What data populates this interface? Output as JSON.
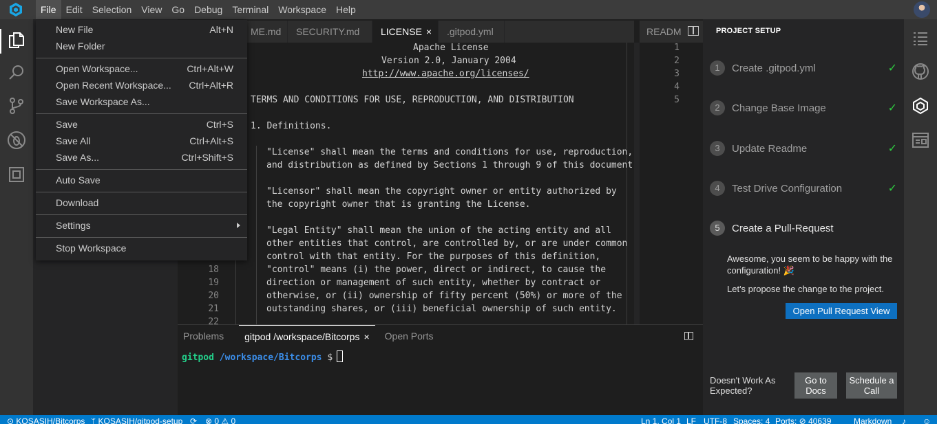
{
  "menubar": {
    "items": [
      "File",
      "Edit",
      "Selection",
      "View",
      "Go",
      "Debug",
      "Terminal",
      "Workspace",
      "Help"
    ],
    "active": "File"
  },
  "file_menu": {
    "items": [
      {
        "label": "New File",
        "shortcut": "Alt+N"
      },
      {
        "label": "New Folder",
        "shortcut": ""
      },
      {
        "label": "Open Workspace...",
        "shortcut": "Ctrl+Alt+W"
      },
      {
        "label": "Open Recent Workspace...",
        "shortcut": "Ctrl+Alt+R"
      },
      {
        "label": "Save Workspace As...",
        "shortcut": ""
      },
      {
        "label": "Save",
        "shortcut": "Ctrl+S"
      },
      {
        "label": "Save All",
        "shortcut": "Ctrl+Alt+S"
      },
      {
        "label": "Save As...",
        "shortcut": "Ctrl+Shift+S"
      },
      {
        "label": "Auto Save",
        "shortcut": ""
      },
      {
        "label": "Download",
        "shortcut": ""
      },
      {
        "label": "Settings",
        "shortcut": ""
      },
      {
        "label": "Stop Workspace",
        "shortcut": ""
      }
    ]
  },
  "editor_tabs": [
    {
      "label": "ME.md"
    },
    {
      "label": "SECURITY.md"
    },
    {
      "label": "LICENSE",
      "active": true,
      "close": "×"
    },
    {
      "label": ".gitpod.yml"
    }
  ],
  "editor": {
    "lines": [
      {
        "n": "",
        "text": "Apache License"
      },
      {
        "n": "",
        "text": "Version 2.0, January 2004"
      },
      {
        "n": "",
        "text": "http://www.apache.org/licenses/"
      },
      {
        "n": "",
        "text": ""
      },
      {
        "n": "",
        "text": "TERMS AND CONDITIONS FOR USE, REPRODUCTION, AND DISTRIBUTION"
      },
      {
        "n": "",
        "text": ""
      },
      {
        "n": "",
        "text": "1. Definitions."
      },
      {
        "n": "",
        "text": ""
      },
      {
        "n": "",
        "text": "\"License\" shall mean the terms and conditions for use, reproduction,"
      },
      {
        "n": "",
        "text": "and distribution as defined by Sections 1 through 9 of this document."
      },
      {
        "n": "",
        "text": ""
      },
      {
        "n": "",
        "text": "\"Licensor\" shall mean the copyright owner or entity authorized by"
      },
      {
        "n": "",
        "text": "the copyright owner that is granting the License."
      },
      {
        "n": "",
        "text": ""
      },
      {
        "n": "",
        "text": "\"Legal Entity\" shall mean the union of the acting entity and all"
      },
      {
        "n": "",
        "text": "other entities that control, are controlled by, or are under common"
      },
      {
        "n": "",
        "text": "control with that entity. For the purposes of this definition,"
      },
      {
        "n": "18",
        "text": "\"control\" means (i) the power, direct or indirect, to cause the"
      },
      {
        "n": "19",
        "text": "direction or management of such entity, whether by contract or"
      },
      {
        "n": "20",
        "text": "otherwise, or (ii) ownership of fifty percent (50%) or more of the"
      },
      {
        "n": "21",
        "text": "outstanding shares, or (iii) beneficial ownership of such entity."
      },
      {
        "n": "22",
        "text": ""
      }
    ]
  },
  "readme_pane": {
    "tab": "READM",
    "lines": [
      "1",
      "2",
      "3",
      "4",
      "5"
    ]
  },
  "panel": {
    "tabs": [
      {
        "label": "Problems"
      },
      {
        "label": "gitpod /workspace/Bitcorps",
        "active": true,
        "close": "×"
      },
      {
        "label": "Open Ports"
      }
    ],
    "terminal": {
      "user": "gitpod",
      "path": "/workspace/Bitcorps",
      "prompt": "$"
    }
  },
  "setup": {
    "title": "PROJECT SETUP",
    "steps": [
      {
        "num": "1",
        "label": "Create .gitpod.yml",
        "done": true
      },
      {
        "num": "2",
        "label": "Change Base Image",
        "done": true
      },
      {
        "num": "3",
        "label": "Update Readme",
        "done": true
      },
      {
        "num": "4",
        "label": "Test Drive Configuration",
        "done": true
      },
      {
        "num": "5",
        "label": "Create a Pull-Request",
        "done": false
      }
    ],
    "check_glyph": "✓",
    "message": "Awesome, you seem to be happy with the configuration! 🎉",
    "message2": "Let's propose the change to the project.",
    "pr_button": "Open Pull Request View",
    "not_working": "Doesn't Work As Expected?",
    "docs_button": "Go to Docs",
    "call_button": "Schedule a Call"
  },
  "statusbar": {
    "repo": "KOSASIH/Bitcorps",
    "branch": "KOSASIH/gitpod-setup",
    "problems": "0",
    "warnings": "0",
    "position": "Ln 1, Col 1",
    "eol": "LF",
    "encoding": "UTF-8",
    "spaces": "Spaces: 4",
    "ports": "Ports: ⊘ 40639",
    "language": "Markdown"
  },
  "colors": {
    "accent": "#007acc",
    "check": "#2ecc40",
    "button": "#0e70c0",
    "terminal_user": "#23d18b",
    "terminal_path": "#3b8eea"
  }
}
